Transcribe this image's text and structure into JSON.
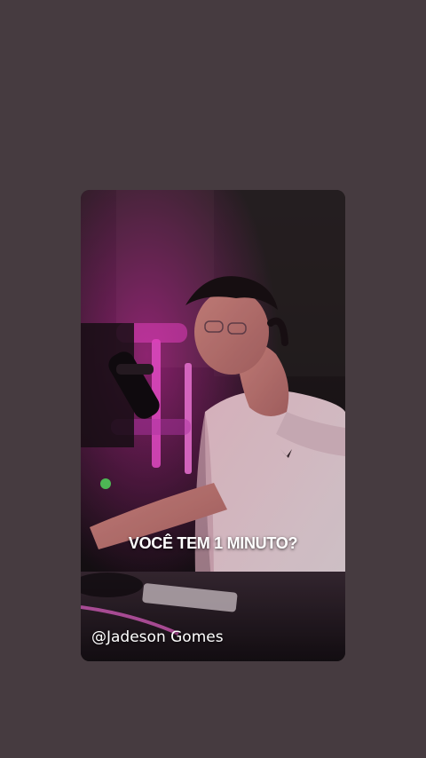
{
  "story": {
    "caption": "VOCÊ TEM 1 MINUTO?",
    "handle": "@Jadeson Gomes"
  },
  "colors": {
    "page_background": "#463b40",
    "neon_accent": "#ff3fd0"
  }
}
